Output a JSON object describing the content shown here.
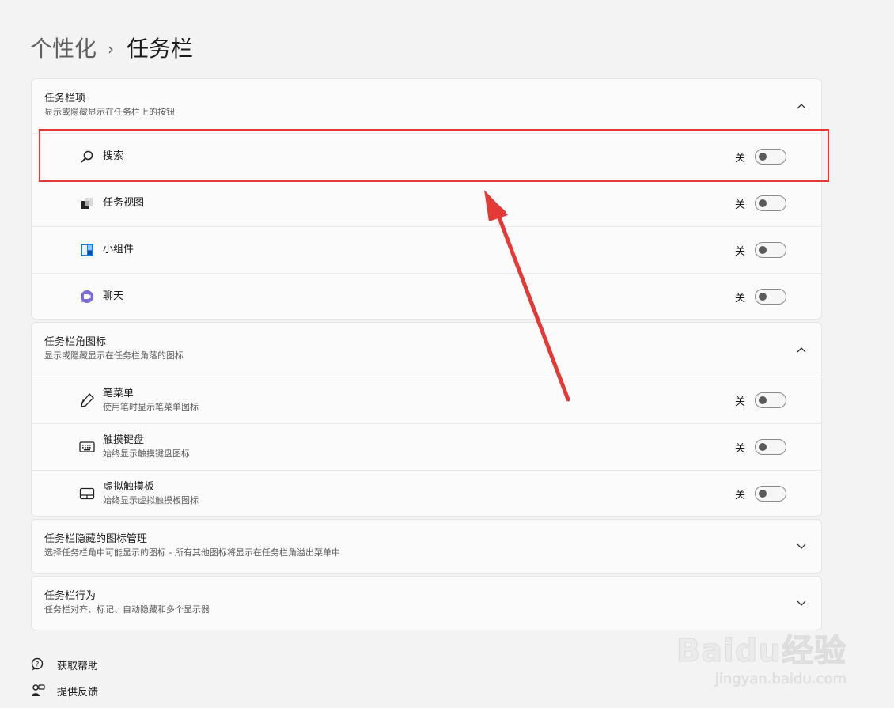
{
  "breadcrumb": {
    "parent": "个性化",
    "separator": "›",
    "current": "任务栏"
  },
  "sections": [
    {
      "title": "任务栏项",
      "desc": "显示或隐藏显示在任务栏上的按钮",
      "expanded": true,
      "items": [
        {
          "label": "搜索",
          "icon": "search-icon",
          "state": "关",
          "on": false
        },
        {
          "label": "任务视图",
          "icon": "task-view-icon",
          "state": "关",
          "on": false
        },
        {
          "label": "小组件",
          "icon": "widgets-icon",
          "state": "关",
          "on": false
        },
        {
          "label": "聊天",
          "icon": "chat-icon",
          "state": "关",
          "on": false
        }
      ]
    },
    {
      "title": "任务栏角图标",
      "desc": "显示或隐藏显示在任务栏角落的图标",
      "expanded": true,
      "items": [
        {
          "label": "笔菜单",
          "sub": "使用笔时显示笔菜单图标",
          "icon": "pen-icon",
          "state": "关",
          "on": false
        },
        {
          "label": "触摸键盘",
          "sub": "始终显示触摸键盘图标",
          "icon": "keyboard-icon",
          "state": "关",
          "on": false
        },
        {
          "label": "虚拟触摸板",
          "sub": "始终显示虚拟触摸板图标",
          "icon": "touchpad-icon",
          "state": "关",
          "on": false
        }
      ]
    },
    {
      "title": "任务栏隐藏的图标管理",
      "desc": "选择任务栏角中可能显示的图标 - 所有其他图标将显示在任务栏角溢出菜单中",
      "expanded": false
    },
    {
      "title": "任务栏行为",
      "desc": "任务栏对齐、标记、自动隐藏和多个显示器",
      "expanded": false
    }
  ],
  "footer": {
    "help": "获取帮助",
    "feedback": "提供反馈"
  },
  "watermark": {
    "logo": "Baidu经验",
    "url": "jingyan.baidu.com"
  },
  "colors": {
    "highlight": "#e53935",
    "arrow": "#e53935",
    "card_bg": "#fbfbfb",
    "page_bg": "#f3f3f3"
  }
}
